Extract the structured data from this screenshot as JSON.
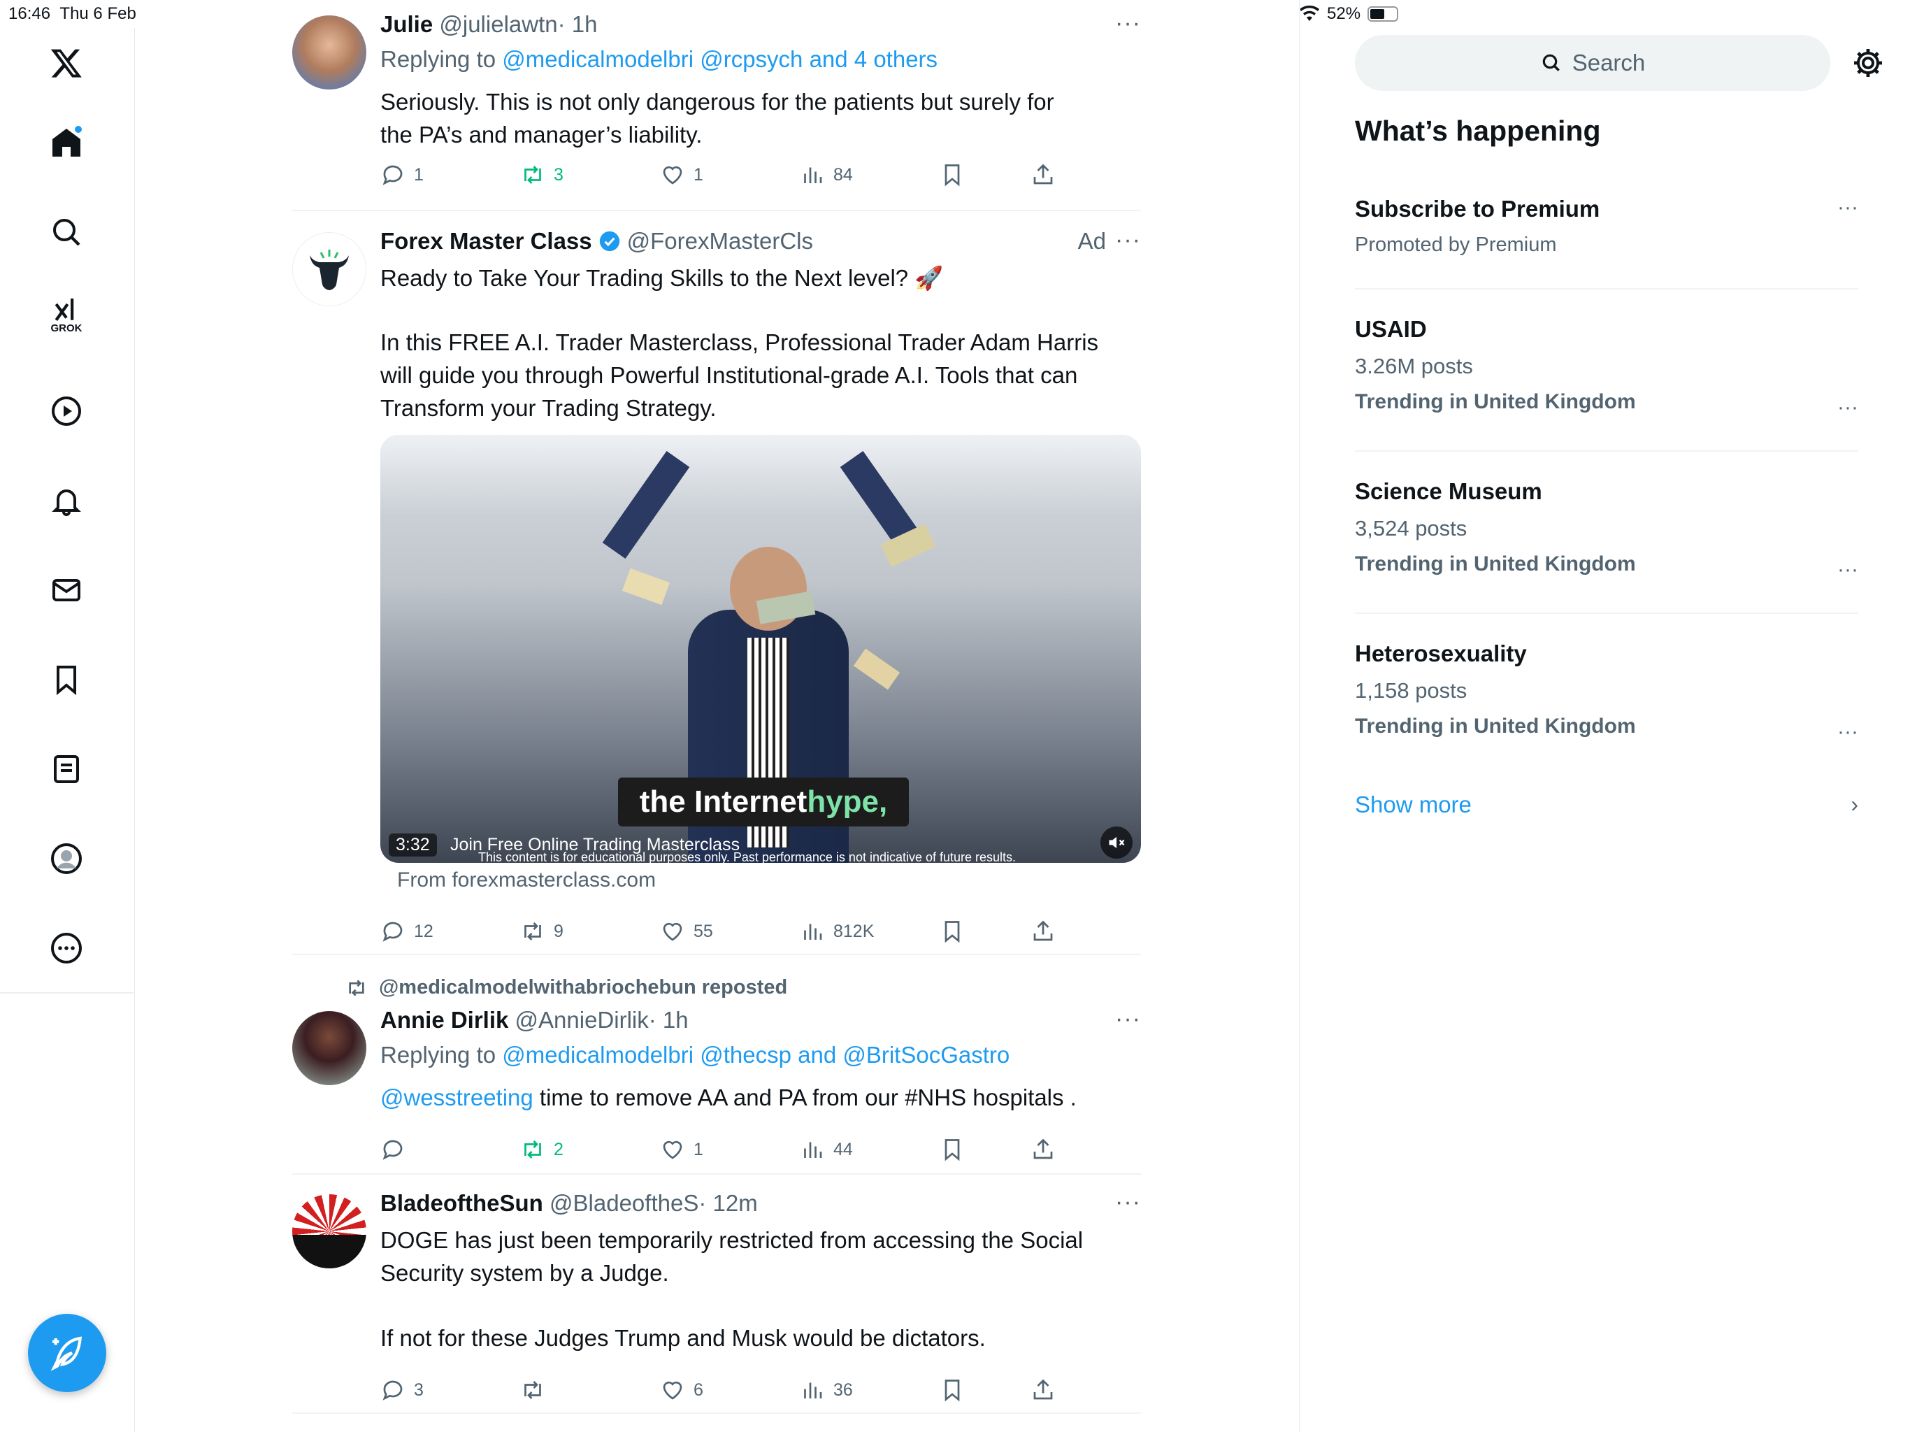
{
  "status": {
    "time": "16:46",
    "date": "Thu 6 Feb",
    "battery": "52%"
  },
  "nav": {
    "items": [
      {
        "name": "x-logo-icon"
      },
      {
        "name": "home-icon"
      },
      {
        "name": "search-icon"
      },
      {
        "name": "grok-icon",
        "label": "GROK"
      },
      {
        "name": "video-icon"
      },
      {
        "name": "notifications-icon"
      },
      {
        "name": "messages-icon"
      },
      {
        "name": "bookmarks-icon"
      },
      {
        "name": "lists-icon"
      },
      {
        "name": "profile-icon"
      },
      {
        "name": "more-icon"
      }
    ]
  },
  "posts": [
    {
      "name": "Julie",
      "handle": "@julielawtn",
      "time": "· 1h",
      "replying": "Replying to",
      "replying_to": "@medicalmodelbri @rcpsych and 4 others",
      "text": "Seriously. This is not only dangerous for the patients but surely for the PA’s and manager’s liability.",
      "replies": "1",
      "reposts": "3",
      "likes": "1",
      "views": "84"
    },
    {
      "name": "Forex Master Class",
      "handle": "@ForexMasterCls",
      "ad": "Ad",
      "text1": "Ready to Take Your Trading Skills to the Next level? 🚀",
      "text2": "In this FREE A.I. Trader Masterclass, Professional Trader Adam Harris will guide you through Powerful Institutional-grade A.I. Tools that can Transform your Trading Strategy.",
      "caption_a": "the Internet ",
      "caption_b": "hype,",
      "duration": "3:32",
      "video_title": "Join Free Online Trading Masterclass",
      "disclaimer": "This content is for educational purposes only. Past performance is not indicative of future results.",
      "from": "From forexmasterclass.com",
      "replies": "12",
      "reposts": "9",
      "likes": "55",
      "views": "812K"
    },
    {
      "reposted_by": "@medicalmodelwithabriochebun reposted",
      "name": "Annie Dirlik",
      "handle": "@AnnieDirlik",
      "time": "· 1h",
      "replying": "Replying to",
      "replying_to": "@medicalmodelbri @thecsp and @BritSocGastro",
      "mention": "@wesstreeting",
      "text": " time to remove AA and PA from our #NHS hospitals .",
      "replies": "",
      "reposts": "2",
      "likes": "1",
      "views": "44"
    },
    {
      "name": "BladeoftheSun",
      "handle": "@BladeoftheS",
      "time": "· 12m",
      "text1": "DOGE has just been temporarily restricted from accessing the Social Security system by a Judge.",
      "text2": "If not for these Judges Trump and Musk would be dictators.",
      "replies": "3",
      "reposts": "",
      "likes": "6",
      "views": "36"
    }
  ],
  "sidebar": {
    "search_placeholder": "Search",
    "heading": "What’s happening",
    "promo": {
      "title": "Subscribe to Premium",
      "sub": "Promoted by Premium"
    },
    "trends": [
      {
        "title": "USAID",
        "posts": "3.26M posts",
        "context": "Trending in United Kingdom"
      },
      {
        "title": "Science Museum",
        "posts": "3,524 posts",
        "context": "Trending in United Kingdom"
      },
      {
        "title": "Heterosexuality",
        "posts": "1,158 posts",
        "context": "Trending in United Kingdom"
      }
    ],
    "show_more": "Show more"
  },
  "colors": {
    "accent": "#1d9bf0",
    "repost_green": "#00ba7c",
    "muted": "#536471"
  }
}
